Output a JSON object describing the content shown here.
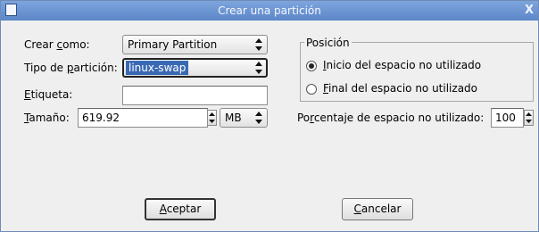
{
  "window": {
    "title": "Crear una partición",
    "close_glyph": "X",
    "app_icon": "window-icon"
  },
  "form": {
    "create_as": {
      "label_pre": "Crear ",
      "label_mnemonic": "c",
      "label_post": "omo:",
      "value": "Primary Partition"
    },
    "partition_type": {
      "label_pre": "Tipo de ",
      "label_mnemonic": "p",
      "label_post": "artición:",
      "value": "linux-swap"
    },
    "tag": {
      "label_pre": "",
      "label_mnemonic": "E",
      "label_post": "tiqueta:",
      "value": ""
    },
    "size": {
      "label_pre": "",
      "label_mnemonic": "T",
      "label_post": "amaño:",
      "value": "619.92",
      "unit": "MB"
    }
  },
  "position": {
    "title": "Posición",
    "options": [
      {
        "mnemonic": "I",
        "rest": "nicio del espacio no utilizado",
        "selected": true
      },
      {
        "mnemonic": "F",
        "rest": "inal del espacio no utilizado",
        "selected": false
      }
    ]
  },
  "percentage": {
    "label_pre": "Po",
    "label_mnemonic": "r",
    "label_post": "centaje de espacio no utilizado:",
    "value": "100"
  },
  "buttons": {
    "accept": {
      "mnemonic": "A",
      "rest": "ceptar"
    },
    "cancel": {
      "mnemonic": "C",
      "rest": "ancelar"
    }
  },
  "colors": {
    "titlebar": "#6b93d2",
    "selection": "#3a69b3",
    "dialog_bg": "#efefef"
  }
}
